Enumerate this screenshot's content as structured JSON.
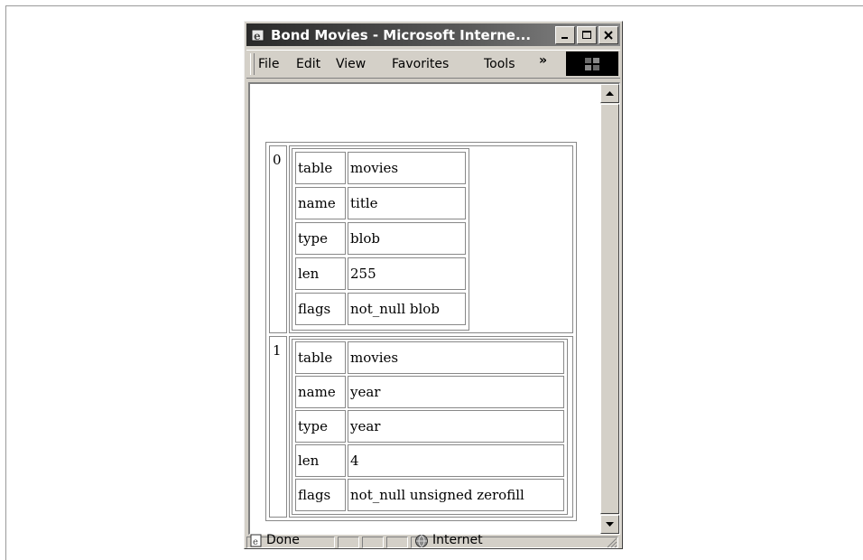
{
  "window": {
    "title": "Bond Movies - Microsoft Interne..."
  },
  "menu": {
    "items": [
      "File",
      "Edit",
      "View",
      "Favorites",
      "Tools"
    ],
    "overflow": "»"
  },
  "records": [
    {
      "index": "0",
      "rows": [
        {
          "key": "table",
          "value": "movies"
        },
        {
          "key": "name",
          "value": "title"
        },
        {
          "key": "type",
          "value": "blob"
        },
        {
          "key": "len",
          "value": "255"
        },
        {
          "key": "flags",
          "value": "not_null blob"
        }
      ]
    },
    {
      "index": "1",
      "rows": [
        {
          "key": "table",
          "value": "movies"
        },
        {
          "key": "name",
          "value": "year"
        },
        {
          "key": "type",
          "value": "year"
        },
        {
          "key": "len",
          "value": "4"
        },
        {
          "key": "flags",
          "value": "not_null unsigned zerofill"
        }
      ]
    }
  ],
  "status": {
    "text": "Done",
    "zone": "Internet"
  }
}
